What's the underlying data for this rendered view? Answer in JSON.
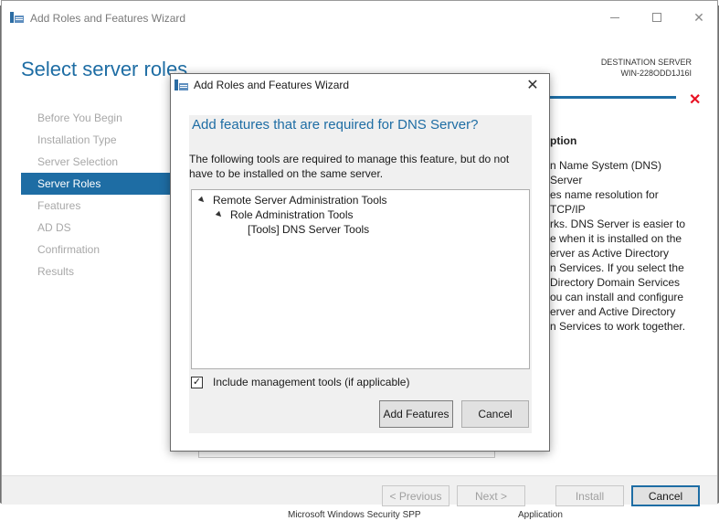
{
  "background": {
    "bottom_fragments": [
      "Microsoft Windows Security SPP",
      "Application"
    ]
  },
  "main_window": {
    "title": "Add Roles and Features Wizard",
    "page_heading": "Select server roles",
    "destination_label": "DESTINATION SERVER",
    "destination_server": "WIN-228ODD1J16I",
    "nav_items": [
      {
        "label": "Before You Begin",
        "active": false
      },
      {
        "label": "Installation Type",
        "active": false
      },
      {
        "label": "Server Selection",
        "active": false
      },
      {
        "label": "Server Roles",
        "active": true
      },
      {
        "label": "Features",
        "active": false
      },
      {
        "label": "AD DS",
        "active": false
      },
      {
        "label": "Confirmation",
        "active": false
      },
      {
        "label": "Results",
        "active": false
      }
    ],
    "description_title": "ption",
    "description_lines": [
      "n Name System (DNS) Server",
      "es name resolution for TCP/IP",
      "rks. DNS Server is easier to",
      "e when it is installed on the",
      "erver as Active Directory",
      "n Services. If you select the",
      "Directory Domain Services",
      "ou can install and configure",
      "erver and Active Directory",
      "n Services to work together."
    ],
    "buttons": {
      "previous": "< Previous",
      "next": "Next >",
      "install": "Install",
      "cancel": "Cancel"
    },
    "error_icon": "red-x-icon",
    "accent_color": "#1e6da4"
  },
  "dialog": {
    "title": "Add Roles and Features Wizard",
    "heading": "Add features that are required for DNS Server?",
    "description": "The following tools are required to manage this feature, but do not have to be installed on the same server.",
    "tree": [
      {
        "label": "Remote Server Administration Tools",
        "level": 0,
        "expanded": true
      },
      {
        "label": "Role Administration Tools",
        "level": 1,
        "expanded": true
      },
      {
        "label": "[Tools] DNS Server Tools",
        "level": 2,
        "expanded": false
      }
    ],
    "checkbox_label": "Include management tools (if applicable)",
    "checkbox_checked": true,
    "add_features_label": "Add Features",
    "cancel_label": "Cancel"
  }
}
